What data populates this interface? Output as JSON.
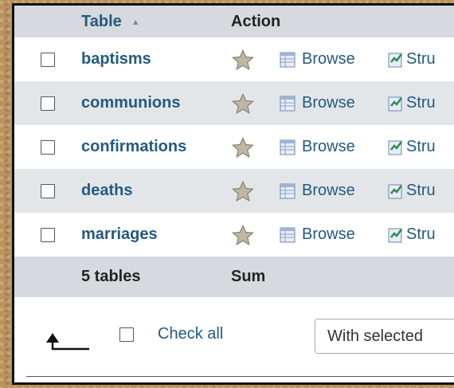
{
  "table": {
    "header": {
      "table_label": "Table",
      "action_label": "Action"
    },
    "rows": [
      {
        "name": "baptisms",
        "browse": "Browse",
        "structure": "Stru"
      },
      {
        "name": "communions",
        "browse": "Browse",
        "structure": "Stru"
      },
      {
        "name": "confirmations",
        "browse": "Browse",
        "structure": "Stru"
      },
      {
        "name": "deaths",
        "browse": "Browse",
        "structure": "Stru"
      },
      {
        "name": "marriages",
        "browse": "Browse",
        "structure": "Stru"
      }
    ],
    "footer": {
      "count_label": "5 tables",
      "sum_label": "Sum"
    }
  },
  "bulk": {
    "check_all_label": "Check all",
    "with_selected_label": "With selected"
  },
  "colors": {
    "link": "#235a81",
    "header_bg": "#d6d9dd",
    "row_alt_bg": "#e3e6e9"
  }
}
